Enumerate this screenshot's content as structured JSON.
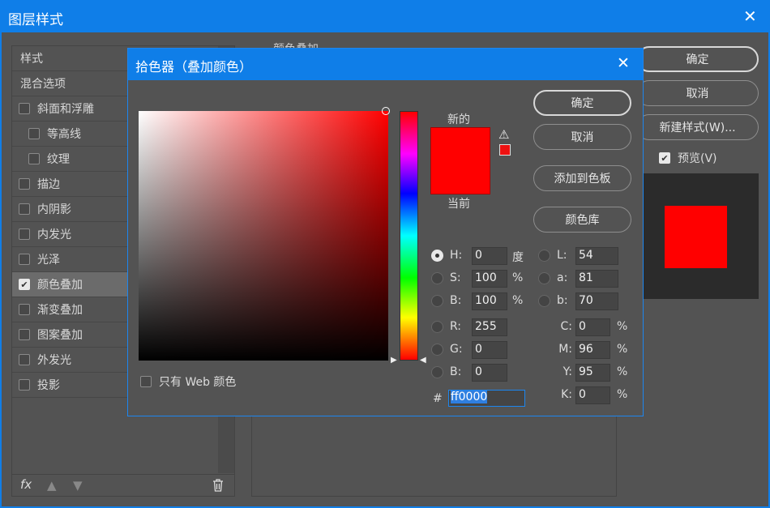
{
  "window": {
    "title": "图层样式",
    "close": "✕"
  },
  "sidebar": {
    "items": [
      {
        "label": "样式",
        "checkbox": false
      },
      {
        "label": "混合选项",
        "checkbox": false
      },
      {
        "label": "斜面和浮雕",
        "checkbox": true,
        "checked": false,
        "indent": 0
      },
      {
        "label": "等高线",
        "checkbox": true,
        "checked": false,
        "indent": 1
      },
      {
        "label": "纹理",
        "checkbox": true,
        "checked": false,
        "indent": 1
      },
      {
        "label": "描边",
        "checkbox": true,
        "checked": false,
        "indent": 0
      },
      {
        "label": "内阴影",
        "checkbox": true,
        "checked": false,
        "indent": 0
      },
      {
        "label": "内发光",
        "checkbox": true,
        "checked": false,
        "indent": 0
      },
      {
        "label": "光泽",
        "checkbox": true,
        "checked": false,
        "indent": 0
      },
      {
        "label": "颜色叠加",
        "checkbox": true,
        "checked": true,
        "indent": 0,
        "selected": true
      },
      {
        "label": "渐变叠加",
        "checkbox": true,
        "checked": false,
        "indent": 0
      },
      {
        "label": "图案叠加",
        "checkbox": true,
        "checked": false,
        "indent": 0
      },
      {
        "label": "外发光",
        "checkbox": true,
        "checked": false,
        "indent": 0
      },
      {
        "label": "投影",
        "checkbox": true,
        "checked": false,
        "indent": 0
      }
    ],
    "footer": {
      "fx": "fx"
    }
  },
  "main": {
    "section_title": "颜色叠加"
  },
  "right": {
    "ok": "确定",
    "cancel": "取消",
    "new_style": "新建样式(W)...",
    "preview": "预览(V)",
    "preview_checked": true,
    "preview_color": "#ff0000"
  },
  "picker": {
    "title": "拾色器（叠加颜色）",
    "close": "✕",
    "new_label": "新的",
    "current_label": "当前",
    "new_color": "#ff0000",
    "current_color": "#ff0000",
    "ok": "确定",
    "cancel": "取消",
    "add_swatch": "添加到色板",
    "color_library": "颜色库",
    "web_only": "只有 Web 颜色",
    "fields": {
      "H": {
        "label": "H:",
        "value": "0",
        "unit": "度"
      },
      "S": {
        "label": "S:",
        "value": "100",
        "unit": "%"
      },
      "Bv": {
        "label": "B:",
        "value": "100",
        "unit": "%"
      },
      "R": {
        "label": "R:",
        "value": "255"
      },
      "G": {
        "label": "G:",
        "value": "0"
      },
      "Bb": {
        "label": "B:",
        "value": "0"
      },
      "L": {
        "label": "L:",
        "value": "54"
      },
      "a": {
        "label": "a:",
        "value": "81"
      },
      "b": {
        "label": "b:",
        "value": "70"
      },
      "C": {
        "label": "C:",
        "value": "0",
        "unit": "%"
      },
      "M": {
        "label": "M:",
        "value": "96",
        "unit": "%"
      },
      "Y": {
        "label": "Y:",
        "value": "95",
        "unit": "%"
      },
      "K": {
        "label": "K:",
        "value": "0",
        "unit": "%"
      }
    },
    "hex_label": "#",
    "hex": "ff0000"
  }
}
